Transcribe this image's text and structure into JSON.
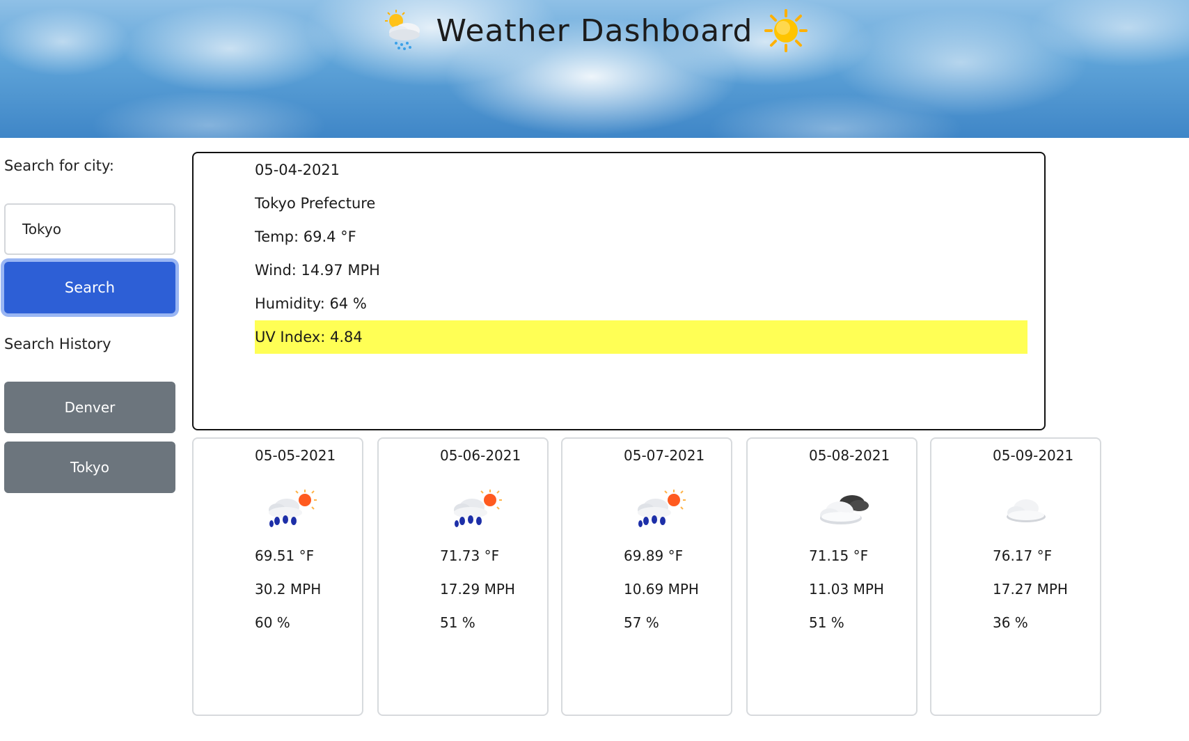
{
  "header": {
    "title": "Weather Dashboard",
    "left_icon": "sun-behind-rain-cloud-icon",
    "right_icon": "sun-icon"
  },
  "sidebar": {
    "search_label": "Search for city:",
    "input_value": "Tokyo",
    "search_button": "Search",
    "history_label": "Search History",
    "history": [
      "Denver",
      "Tokyo"
    ]
  },
  "current": {
    "date": "05-04-2021",
    "city": "Tokyo Prefecture",
    "temp": "Temp: 69.4 °F",
    "wind": "Wind: 14.97 MPH",
    "humidity": "Humidity: 64 %",
    "uv": "UV Index: 4.84",
    "uv_color": "#ffff55"
  },
  "forecast": [
    {
      "date": "05-05-2021",
      "icon": "rain-with-sun-icon",
      "temp": "69.51 °F",
      "wind": "30.2 MPH",
      "humidity": "60 %"
    },
    {
      "date": "05-06-2021",
      "icon": "rain-with-sun-icon",
      "temp": "71.73 °F",
      "wind": "17.29 MPH",
      "humidity": "51 %"
    },
    {
      "date": "05-07-2021",
      "icon": "rain-with-sun-icon",
      "temp": "69.89 °F",
      "wind": "10.69 MPH",
      "humidity": "57 %"
    },
    {
      "date": "05-08-2021",
      "icon": "broken-clouds-icon",
      "temp": "71.15 °F",
      "wind": "11.03 MPH",
      "humidity": "51 %"
    },
    {
      "date": "05-09-2021",
      "icon": "cloud-icon",
      "temp": "76.17 °F",
      "wind": "17.27 MPH",
      "humidity": "36 %"
    }
  ],
  "colors": {
    "search_button": "#2d5fd6",
    "history_button": "#6c757d",
    "uv_moderate": "#ffff55"
  }
}
